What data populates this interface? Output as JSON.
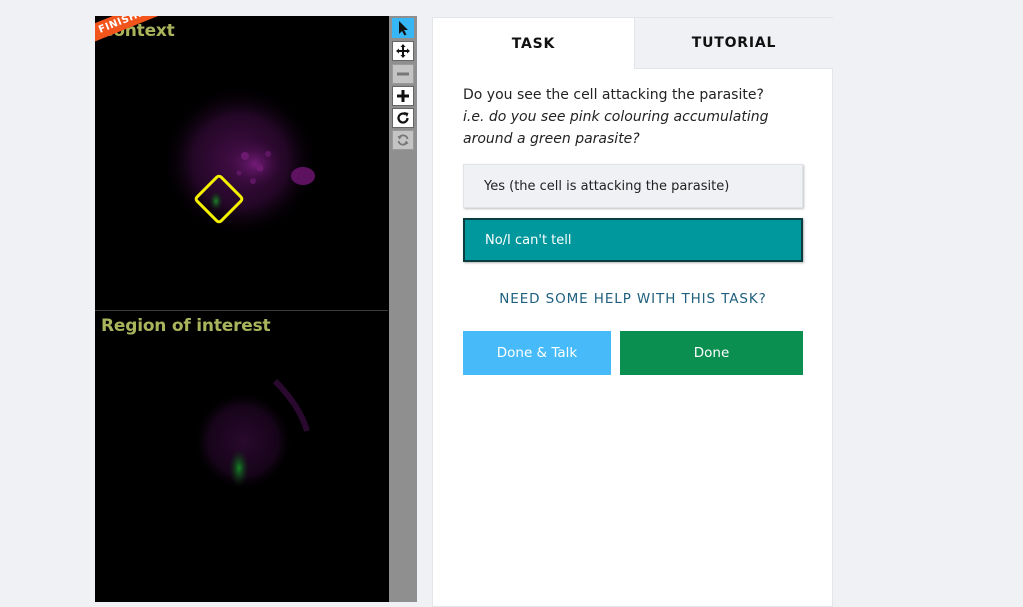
{
  "viewer": {
    "status_ribbon": "FINISHED!",
    "context_label": "Context",
    "roi_label": "Region of interest",
    "tools": [
      {
        "name": "pointer-icon",
        "state": "active"
      },
      {
        "name": "move-icon",
        "state": "normal"
      },
      {
        "name": "zoom-out-icon",
        "state": "disabled"
      },
      {
        "name": "zoom-in-icon",
        "state": "normal"
      },
      {
        "name": "rotate-icon",
        "state": "normal"
      },
      {
        "name": "reset-icon",
        "state": "disabled"
      }
    ]
  },
  "tabs": {
    "task": "TASK",
    "tutorial": "TUTORIAL"
  },
  "task": {
    "question": "Do you see the cell attacking the parasite?",
    "hint": "i.e. do you see pink colouring accumulating around a green parasite?",
    "answers": [
      {
        "label": "Yes (the cell is attacking the parasite)",
        "selected": false
      },
      {
        "label": "No/I can't tell",
        "selected": true
      }
    ],
    "help_link": "NEED SOME HELP WITH THIS TASK?",
    "done_talk_label": "Done & Talk",
    "done_label": "Done"
  },
  "colors": {
    "accent_teal": "#00979d",
    "done_green": "#0a8f51",
    "talk_blue": "#47bbfa",
    "ribbon_orange": "#f2541b",
    "marker_yellow": "#f4f000"
  }
}
